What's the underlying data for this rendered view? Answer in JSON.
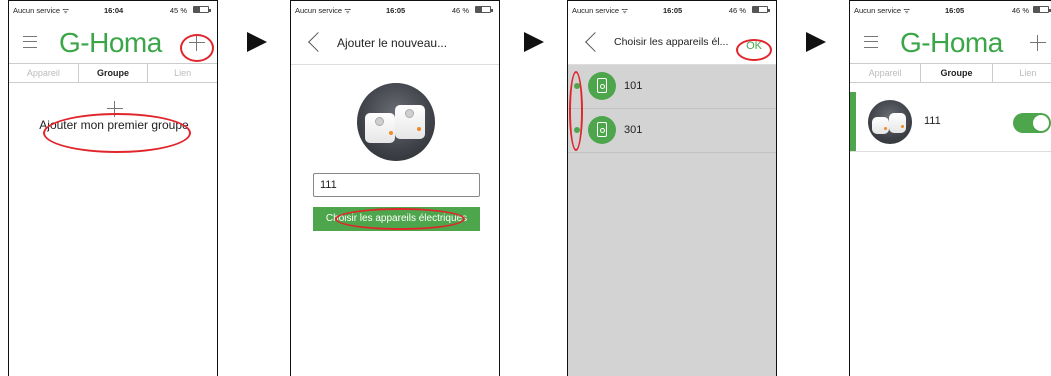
{
  "status_bars": [
    {
      "carrier": "Aucun service ᯤ",
      "time": "16:04",
      "battery": "45 %"
    },
    {
      "carrier": "Aucun service ᯤ",
      "time": "16:05",
      "battery": "46 %"
    },
    {
      "carrier": "Aucun service ᯤ",
      "time": "16:05",
      "battery": "46 %"
    },
    {
      "carrier": "Aucun service ᯤ",
      "time": "16:05",
      "battery": "46 %"
    }
  ],
  "brand": "G-Homa",
  "tabs": [
    "Appareil",
    "Groupe",
    "Lien"
  ],
  "screen1": {
    "add_group_label": "Ajouter mon premier groupe"
  },
  "screen2": {
    "title": "Ajouter le nouveau...",
    "name_value": "111",
    "choose_button": "Choisir les appareils électriques"
  },
  "screen3": {
    "title": "Choisir les appareils él...",
    "ok": "OK",
    "devices": [
      {
        "name": "101"
      },
      {
        "name": "301"
      }
    ]
  },
  "screen4": {
    "group_name": "111"
  },
  "colors": {
    "brand_green": "#3aa648",
    "accent_green": "#4da64b",
    "annotation_red": "#e0262c",
    "list_gray": "#d3d3d3"
  },
  "icons": [
    "menu-icon",
    "plus-icon",
    "back-chevron-icon",
    "smart-plug-icon",
    "toggle-switch",
    "next-step-arrow"
  ]
}
